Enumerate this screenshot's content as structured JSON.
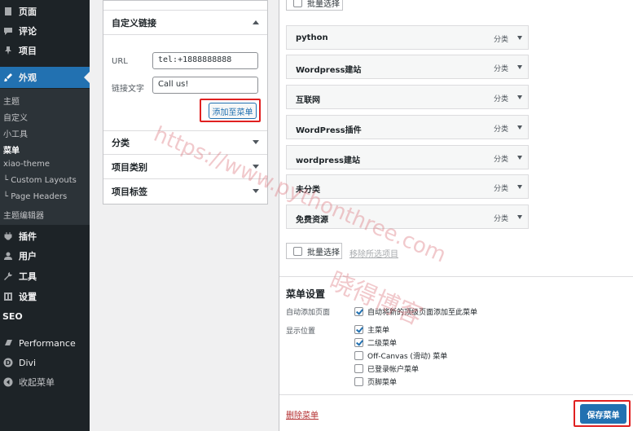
{
  "sidebar": {
    "items": [
      {
        "label": "页面",
        "icon": "page-icon"
      },
      {
        "label": "评论",
        "icon": "comment-icon"
      },
      {
        "label": "项目",
        "icon": "pin-icon"
      },
      {
        "label": "外观",
        "icon": "brush-icon"
      },
      {
        "label": "插件",
        "icon": "plugin-icon"
      },
      {
        "label": "用户",
        "icon": "user-icon"
      },
      {
        "label": "工具",
        "icon": "wrench-icon"
      },
      {
        "label": "设置",
        "icon": "settings-icon"
      },
      {
        "label": "SEO",
        "icon": "seo-icon"
      },
      {
        "label": "Performance",
        "icon": "performance-icon"
      },
      {
        "label": "Divi",
        "icon": "divi-icon"
      },
      {
        "label": "收起菜单",
        "icon": "collapse-icon"
      }
    ],
    "submenu": [
      {
        "label": "主题"
      },
      {
        "label": "自定义"
      },
      {
        "label": "小工具"
      },
      {
        "label": "菜单"
      },
      {
        "label": "xiao-theme"
      },
      {
        "label": "Custom Layouts"
      },
      {
        "label": "Page Headers"
      },
      {
        "label": "主题编辑器"
      }
    ]
  },
  "left_panel": {
    "custom_links": {
      "title": "自定义链接",
      "url_label": "URL",
      "url_value": "tel:+1888888888",
      "text_label": "链接文字",
      "text_value": "Call us!",
      "add_button": "添加至菜单"
    },
    "sections": [
      {
        "title": "分类"
      },
      {
        "title": "项目类别"
      },
      {
        "title": "项目标签"
      }
    ]
  },
  "right_panel": {
    "bulk_select_top": "批量选择",
    "menu_items": [
      {
        "title": "python",
        "type": "分类"
      },
      {
        "title": "Wordpress建站",
        "type": "分类"
      },
      {
        "title": "互联网",
        "type": "分类"
      },
      {
        "title": "WordPress插件",
        "type": "分类"
      },
      {
        "title": "wordpress建站",
        "type": "分类"
      },
      {
        "title": "未分类",
        "type": "分类"
      },
      {
        "title": "免费资源",
        "type": "分类"
      }
    ],
    "bulk_select": "批量选择",
    "remove_selected": "移除所选项目",
    "settings": {
      "title": "菜单设置",
      "auto_add_label": "自动添加页面",
      "auto_add_option": "自动将新的顶级页面添加至此菜单",
      "auto_add_checked": true,
      "location_label": "显示位置",
      "locations": [
        {
          "label": "主菜单",
          "checked": true
        },
        {
          "label": "二级菜单",
          "checked": true
        },
        {
          "label": "Off-Canvas (滑动) 菜单",
          "checked": false
        },
        {
          "label": "已登录帐户菜单",
          "checked": false
        },
        {
          "label": "页脚菜单",
          "checked": false
        }
      ]
    },
    "delete_menu": "删除菜单",
    "save_menu": "保存菜单"
  },
  "watermark": {
    "url": "https://www.pythonthree.com",
    "brand": "晓得博客"
  }
}
